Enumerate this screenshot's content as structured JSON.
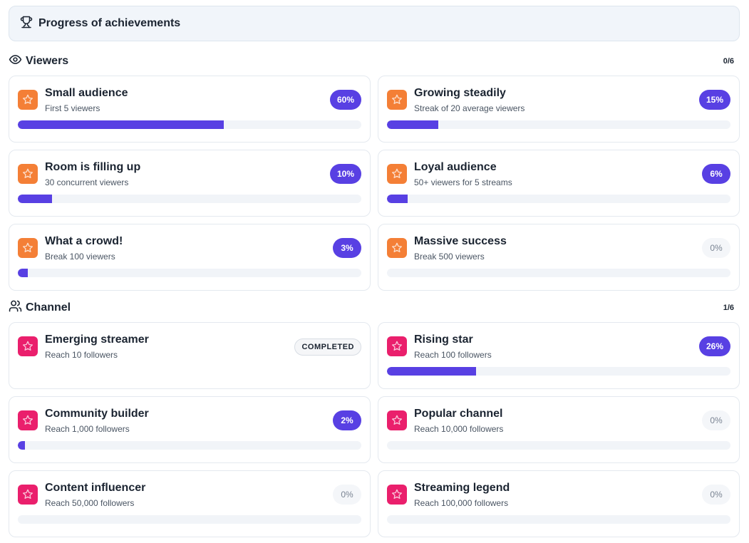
{
  "header": {
    "title": "Progress of achievements"
  },
  "colors": {
    "accent": "#5840e3",
    "viewers_icon": "#f47f36",
    "channel_icon": "#ea1f6c",
    "track": "#f1f4f8"
  },
  "sections": [
    {
      "label": "Viewers",
      "count": "0/6",
      "icon": "eye-icon",
      "items": [
        {
          "name": "Small audience",
          "desc": "First 5 viewers",
          "progress": 60,
          "badge": "60%",
          "status": "active"
        },
        {
          "name": "Growing steadily",
          "desc": "Streak of 20 average viewers",
          "progress": 15,
          "badge": "15%",
          "status": "active"
        },
        {
          "name": "Room is filling up",
          "desc": "30 concurrent viewers",
          "progress": 10,
          "badge": "10%",
          "status": "active"
        },
        {
          "name": "Loyal audience",
          "desc": "50+ viewers for 5 streams",
          "progress": 6,
          "badge": "6%",
          "status": "active"
        },
        {
          "name": "What a crowd!",
          "desc": "Break 100 viewers",
          "progress": 3,
          "badge": "3%",
          "status": "active"
        },
        {
          "name": "Massive success",
          "desc": "Break 500 viewers",
          "progress": 0,
          "badge": "0%",
          "status": "zero"
        }
      ]
    },
    {
      "label": "Channel",
      "count": "1/6",
      "icon": "users-icon",
      "items": [
        {
          "name": "Emerging streamer",
          "desc": "Reach 10 followers",
          "progress": 100,
          "badge": "COMPLETED",
          "status": "done"
        },
        {
          "name": "Rising star",
          "desc": "Reach 100 followers",
          "progress": 26,
          "badge": "26%",
          "status": "active"
        },
        {
          "name": "Community builder",
          "desc": "Reach 1,000 followers",
          "progress": 2,
          "badge": "2%",
          "status": "active"
        },
        {
          "name": "Popular channel",
          "desc": "Reach 10,000 followers",
          "progress": 0,
          "badge": "0%",
          "status": "zero"
        },
        {
          "name": "Content influencer",
          "desc": "Reach 50,000 followers",
          "progress": 0,
          "badge": "0%",
          "status": "zero"
        },
        {
          "name": "Streaming legend",
          "desc": "Reach 100,000 followers",
          "progress": 0,
          "badge": "0%",
          "status": "zero"
        }
      ]
    }
  ]
}
